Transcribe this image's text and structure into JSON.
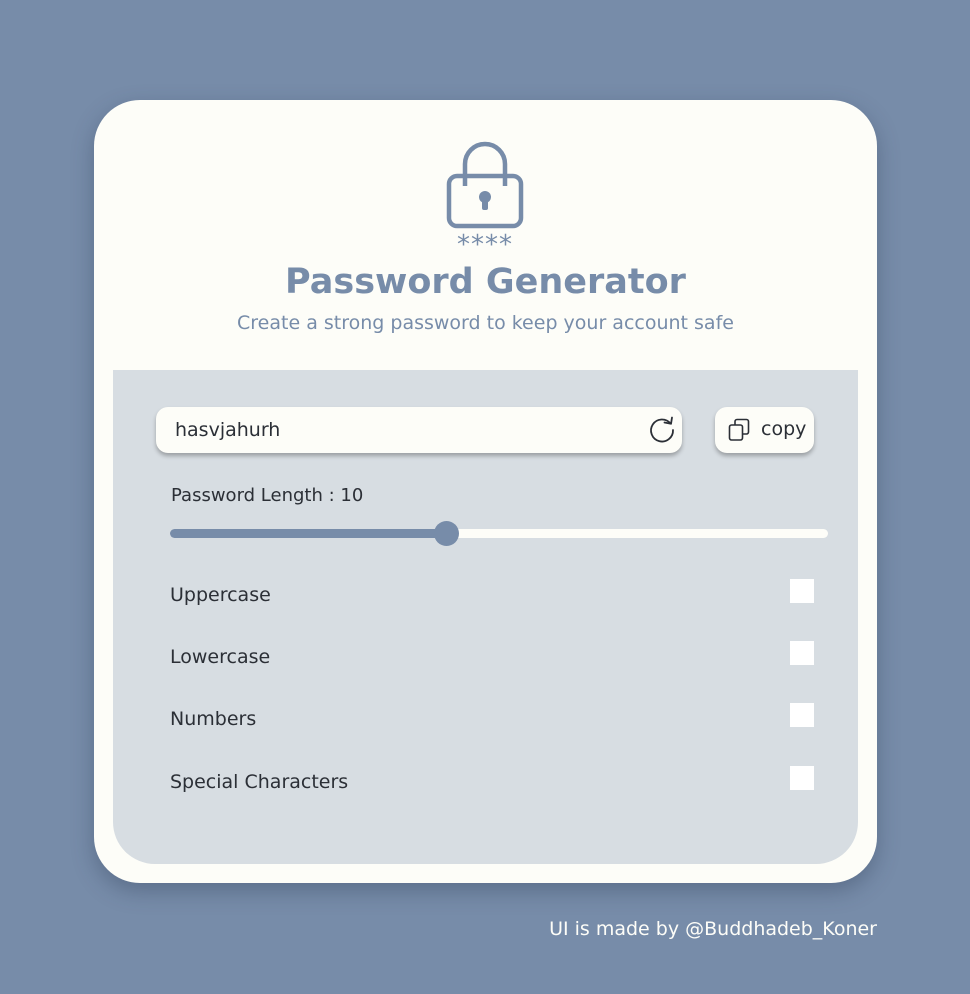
{
  "header": {
    "lock_icon": "lock-icon",
    "stars": "****",
    "title": "Password Generator",
    "subtitle": "Create a strong password to keep your account safe"
  },
  "password": {
    "value": "hasvjahurh",
    "refresh_icon": "refresh-icon"
  },
  "copy_button": {
    "icon": "copy-icon",
    "label": "copy"
  },
  "length": {
    "label": "Password Length : ",
    "value": "10",
    "slider_fraction": 0.42
  },
  "options": [
    {
      "label": "Uppercase",
      "checked": false
    },
    {
      "label": "Lowercase",
      "checked": false
    },
    {
      "label": "Numbers",
      "checked": false
    },
    {
      "label": "Special Characters",
      "checked": false
    }
  ],
  "footer": {
    "credit": "UI is made by @Buddhadeb_Koner"
  },
  "colors": {
    "background": "#778ca9",
    "card": "#fdfdf8",
    "panel": "#d7dde2",
    "accent": "#778ca9",
    "text": "#2b2f36"
  }
}
